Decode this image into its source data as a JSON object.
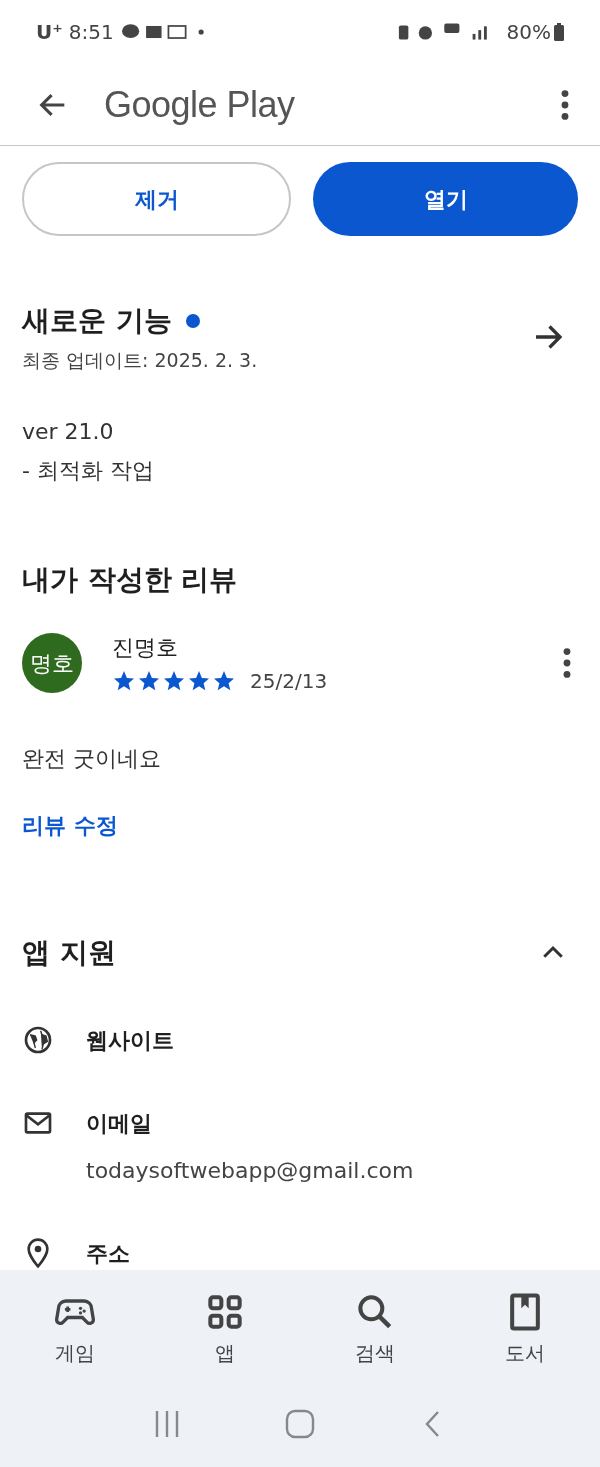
{
  "status_bar": {
    "carrier": "U⁺",
    "time": "8:51",
    "battery": "80%"
  },
  "app_bar": {
    "title": "Google Play"
  },
  "actions": [
    {
      "label": "제거",
      "kind": "outline"
    },
    {
      "label": "열기",
      "kind": "filled"
    }
  ],
  "whats_new": {
    "title": "새로운 기능",
    "unread": true,
    "updated": "최종 업데이트: 2025. 2. 3.",
    "lines": [
      "ver 21.0",
      "- 최적화 작업"
    ]
  },
  "my_review": {
    "title": "내가 작성한 리뷰",
    "avatar": "명호",
    "author": "진명호",
    "stars": 5,
    "date": "25/2/13",
    "text": "완전 굿이네요",
    "edit": "리뷰 수정"
  },
  "app_support": {
    "title": "앱 지원",
    "expanded": true,
    "items": [
      {
        "kind": "website",
        "label": "웹사이트"
      },
      {
        "kind": "email",
        "label": "이메일",
        "value": "todaysoftwebapp@gmail.com"
      },
      {
        "kind": "address",
        "label": "주소"
      }
    ]
  },
  "bottom_nav": [
    {
      "kind": "games",
      "label": "게임",
      "selected": false
    },
    {
      "kind": "apps",
      "label": "앱",
      "selected": false
    },
    {
      "kind": "search",
      "label": "검색",
      "selected": false
    },
    {
      "kind": "books",
      "label": "도서",
      "selected": false
    }
  ]
}
